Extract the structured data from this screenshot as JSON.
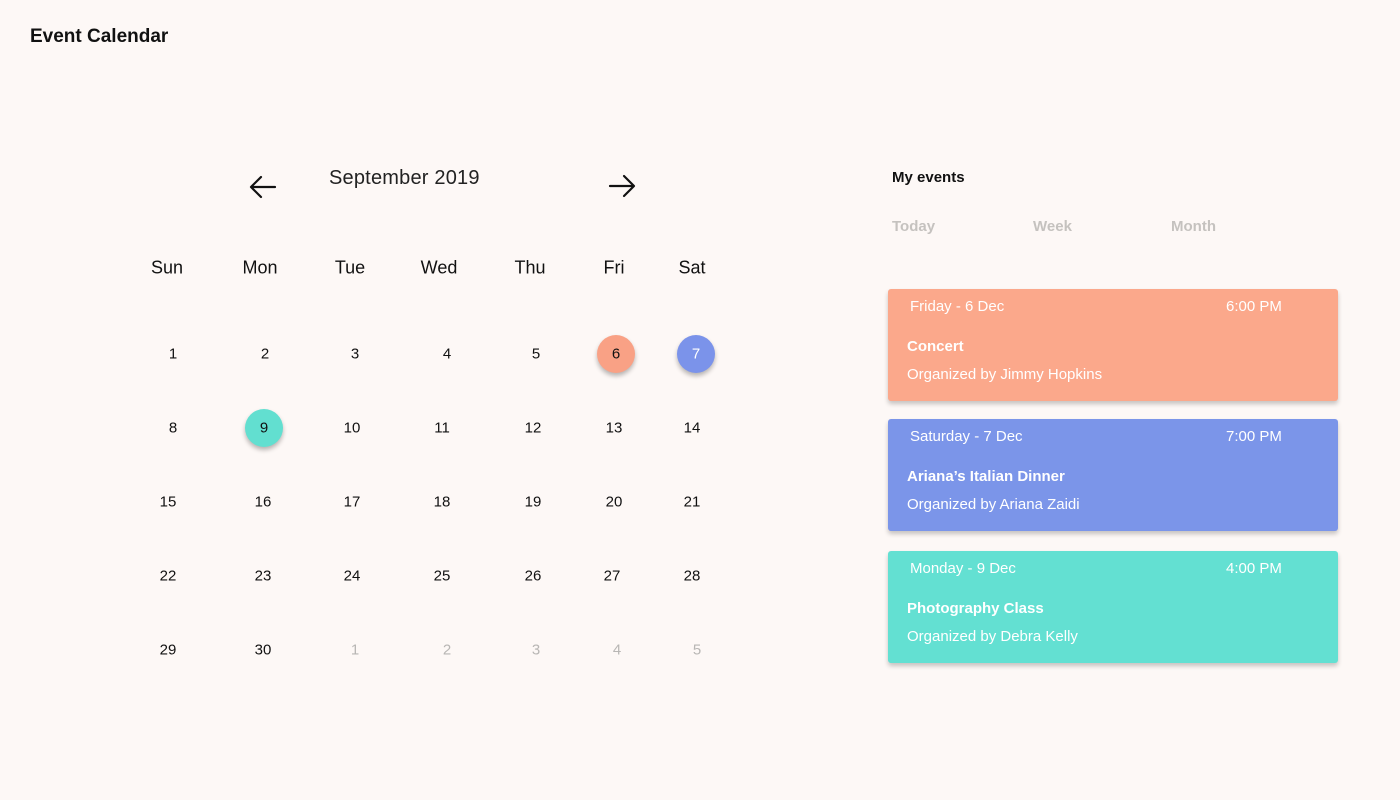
{
  "app": {
    "title": "Event Calendar"
  },
  "calendar": {
    "month_label": "September 2019",
    "prev_icon": "arrow-left-icon",
    "next_icon": "arrow-right-icon",
    "weekdays": [
      "Sun",
      "Mon",
      "Tue",
      "Wed",
      "Thu",
      "Fri",
      "Sat"
    ],
    "weeks": [
      [
        "1",
        "2",
        "3",
        "4",
        "5",
        "6",
        "7"
      ],
      [
        "8",
        "9",
        "10",
        "11",
        "12",
        "13",
        "14"
      ],
      [
        "15",
        "16",
        "17",
        "18",
        "19",
        "20",
        "21"
      ],
      [
        "22",
        "23",
        "24",
        "25",
        "26",
        "27",
        "28"
      ],
      [
        "29",
        "30",
        "1",
        "2",
        "3",
        "4",
        "5"
      ]
    ],
    "muted_cells": [
      [
        4,
        2
      ],
      [
        4,
        3
      ],
      [
        4,
        4
      ],
      [
        4,
        5
      ],
      [
        4,
        6
      ]
    ],
    "marked_days": [
      {
        "week": 0,
        "day": 5,
        "color": "#f9a185",
        "text_color": "#111111"
      },
      {
        "week": 0,
        "day": 6,
        "color": "#7b93ea",
        "text_color": "#ffffff"
      },
      {
        "week": 1,
        "day": 1,
        "color": "#62dfd0",
        "text_color": "#111111"
      }
    ]
  },
  "events_panel": {
    "title": "My events",
    "tabs": [
      {
        "label": "Today",
        "active": false
      },
      {
        "label": "Week",
        "active": false
      },
      {
        "label": "Month",
        "active": true
      }
    ],
    "events": [
      {
        "date": "Friday - 6 Dec",
        "time": "6:00 PM",
        "name": "Concert",
        "organizer": "Organized by Jimmy Hopkins",
        "color": "#fba88b"
      },
      {
        "date": "Saturday - 7 Dec",
        "time": "7:00 PM",
        "name": "Ariana’s Italian Dinner",
        "organizer": "Organized by Ariana Zaidi",
        "color": "#7b95e9"
      },
      {
        "date": "Monday - 9 Dec",
        "time": "4:00 PM",
        "name": "Photography Class",
        "organizer": "Organized by Debra Kelly",
        "color": "#63e0d2"
      }
    ]
  }
}
